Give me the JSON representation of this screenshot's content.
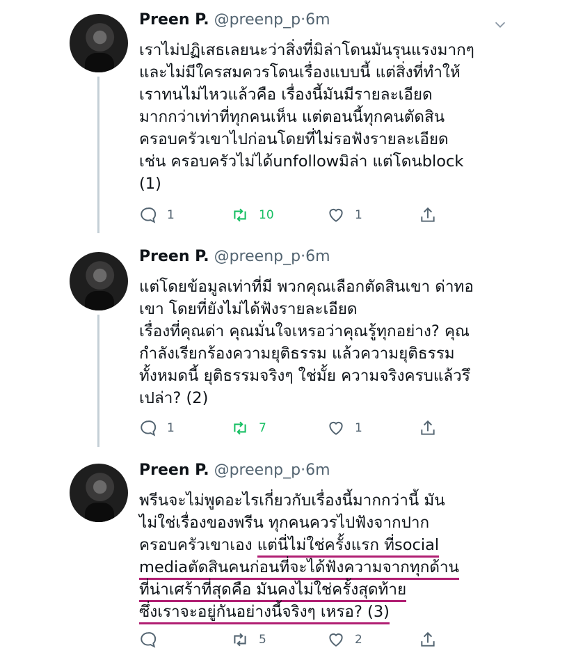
{
  "tweets": [
    {
      "name": "Preen P.",
      "handle": "@preenp_p",
      "time": "6m",
      "lines": [
        "เราไม่ปฏิเสธเลยนะว่าสิ่งที่มิล่าโดนมันรุนแรงมากๆ",
        "และไม่มีใครสมควรโดนเรื่องแบบนี้ แต่สิ่งที่ทำให้",
        "เราทนไม่ไหวแล้วคือ เรื่องนี้มันมีรายละเอียด",
        "มากกว่าเท่าที่ทุกคนเห็น แต่ตอนนี้ทุกคนตัดสิน",
        "ครอบครัวเขาไปก่อนโดยที่ไม่รอฟังรายละเอียด",
        "เช่น ครอบครัวไม่ได้unfollowมิล่า แต่โดนblock",
        "(1)"
      ],
      "replies": "1",
      "retweets": "10",
      "likes": "1"
    },
    {
      "name": "Preen P.",
      "handle": "@preenp_p",
      "time": "6m",
      "lines": [
        "แต่โดยข้อมูลเท่าที่มี พวกคุณเลือกตัดสินเขา ด่าทอ",
        "เขา โดยที่ยังไม่ได้ฟังรายละเอียด",
        "เรื่องที่คุณด่า คุณมั่นใจเหรอว่าคุณรู้ทุกอย่าง? คุณ",
        "กำลังเรียกร้องความยุติธรรม แล้วความยุติธรรม",
        "ทั้งหมดนี้ ยุติธรรมจริงๆ ใช่มั้ย ความจริงครบแล้วรึ",
        "เปล่า? (2)"
      ],
      "replies": "1",
      "retweets": "7",
      "likes": "1"
    },
    {
      "name": "Preen P.",
      "handle": "@preenp_p",
      "time": "6m",
      "lines": [
        "พรีนจะไม่พูดอะไรเกี่ยวกับเรื่องนี้มากกว่านี้ มัน",
        "ไม่ใช่เรื่องของพรีน ทุกคนควรไปฟังจากปาก",
        "ครอบครัวเขาเอง ",
        "แต่นี่ไม่ใช่ครั้งแรก ที่social",
        "mediaตัดสินคนก่อนที่จะได้ฟังความจากทุกด้าน",
        "ที่น่าเศร้าที่สุดคือ มันคงไม่ใช่ครั้งสุดท้าย",
        "ซึ่งเราจะอยู่กันอย่างนี้จริงๆ เหรอ? (3)"
      ],
      "replies": "",
      "retweets": "5",
      "likes": "2"
    }
  ],
  "colors": {
    "retweet_active": "#17bf63",
    "muted": "#536471",
    "underline": "#b01e72"
  }
}
